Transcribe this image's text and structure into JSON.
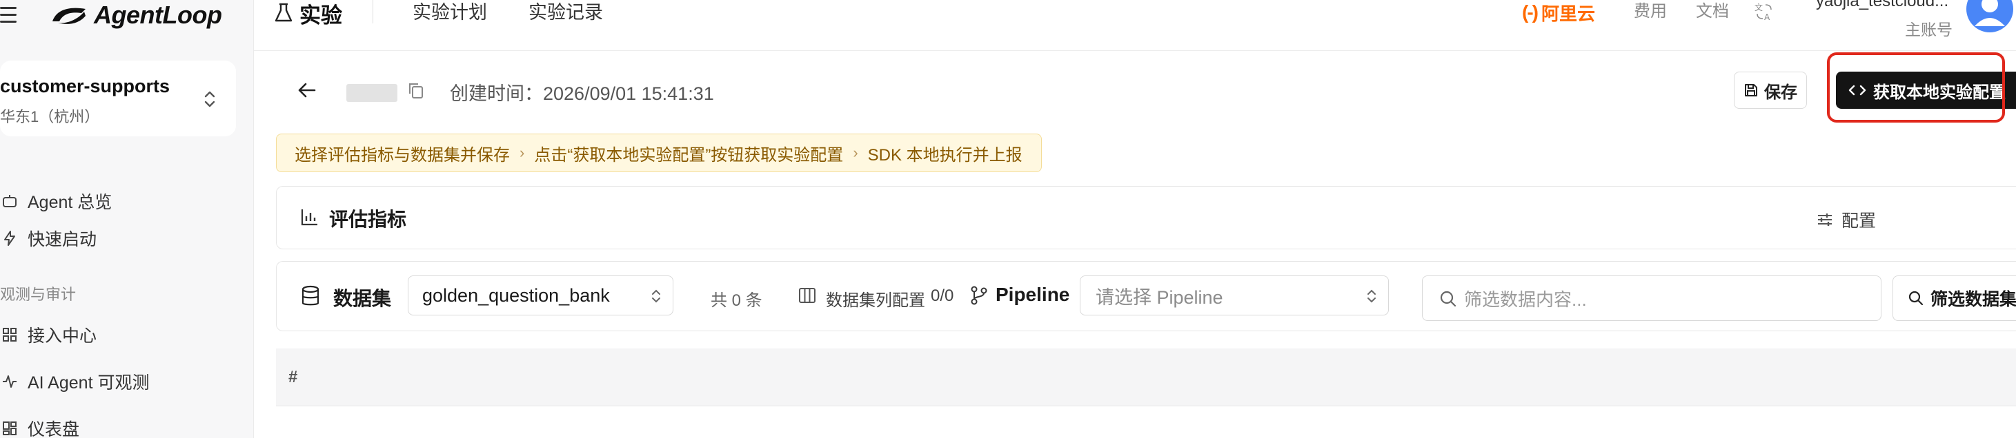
{
  "app": {
    "logo_text": "AgentLoop"
  },
  "sidebar": {
    "workspace": {
      "name": "customer-supports",
      "region": "华东1（杭州）"
    },
    "items": [
      {
        "label": "Agent 总览",
        "icon": "robot-icon"
      },
      {
        "label": "快速启动",
        "icon": "lightning-icon"
      }
    ],
    "section_label": "观测与审计",
    "section_items": [
      {
        "label": "接入中心",
        "icon": "grid-icon"
      },
      {
        "label": "AI Agent 可观测",
        "icon": "pulse-icon"
      },
      {
        "label": "仪表盘",
        "icon": "dashboard-icon"
      }
    ]
  },
  "topbar": {
    "title": "实验",
    "tabs": [
      "实验计划",
      "实验记录"
    ],
    "aliyun_mark": "(-)",
    "aliyun_text": "阿里云",
    "links": [
      "费用",
      "文档"
    ],
    "user_name": "yaojia_testcloud...",
    "user_role": "主账号"
  },
  "experiment": {
    "created_label": "创建时间：",
    "created_time": "2026/09/01 15:41:31",
    "save_label": "保存",
    "get_config_label": "获取本地实验配置"
  },
  "steps": [
    "选择评估指标与数据集并保存",
    "点击“获取本地实验配置”按钮获取实验配置",
    "SDK 本地执行并上报"
  ],
  "metrics": {
    "title": "评估指标",
    "config_label": "配置"
  },
  "dataset": {
    "label": "数据集",
    "selected": "golden_question_bank",
    "count": "共 0 条",
    "columns_label": "数据集列配置",
    "columns_value": "0/0",
    "pipeline_label": "Pipeline",
    "pipeline_placeholder": "请选择 Pipeline",
    "filter_placeholder": "筛选数据内容...",
    "filter_button": "筛选数据集"
  },
  "table": {
    "columns": [
      "#"
    ]
  },
  "colors": {
    "accent_dark": "#141414",
    "aliyun_orange": "#ff6a00",
    "highlight_red": "#e0281c",
    "steps_bg": "#fff8e0"
  }
}
